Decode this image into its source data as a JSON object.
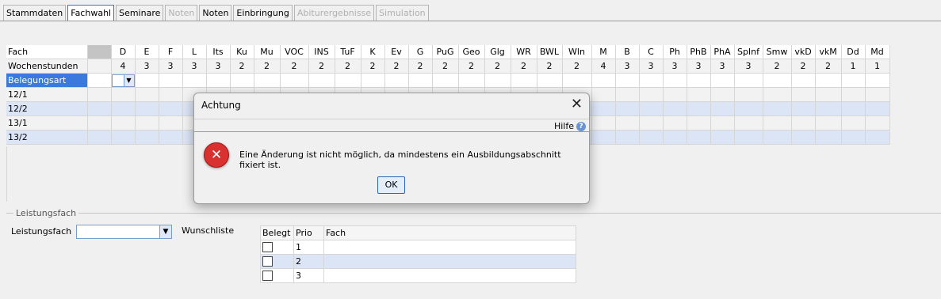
{
  "tabs": [
    {
      "label": "Stammdaten",
      "state": "normal"
    },
    {
      "label": "Fachwahl",
      "state": "active"
    },
    {
      "label": "Seminare",
      "state": "normal"
    },
    {
      "label": "Noten",
      "state": "disabled"
    },
    {
      "label": "Noten",
      "state": "normal"
    },
    {
      "label": "Einbringung",
      "state": "normal"
    },
    {
      "label": "Abiturergebnisse",
      "state": "disabled"
    },
    {
      "label": "Simulation",
      "state": "disabled"
    }
  ],
  "grid": {
    "fach_label": "Fach",
    "wochenstunden_label": "Wochenstunden",
    "subjects": [
      "D",
      "E",
      "F",
      "L",
      "Its",
      "Ku",
      "Mu",
      "VOC",
      "INS",
      "TuF",
      "K",
      "Ev",
      "G",
      "PuG",
      "Geo",
      "Glg",
      "WR",
      "BWL",
      "Wln",
      "M",
      "B",
      "C",
      "Ph",
      "PhB",
      "PhA",
      "SpInf",
      "Smw",
      "vkD",
      "vkM",
      "Dd",
      "Md"
    ],
    "hours": [
      "4",
      "3",
      "3",
      "3",
      "3",
      "2",
      "2",
      "2",
      "2",
      "2",
      "2",
      "2",
      "2",
      "2",
      "2",
      "2",
      "2",
      "2",
      "2",
      "4",
      "3",
      "3",
      "3",
      "3",
      "3",
      "3",
      "2",
      "2",
      "2",
      "1",
      "1"
    ],
    "rows": [
      "Belegungsart",
      "12/1",
      "12/2",
      "13/1",
      "13/2"
    ]
  },
  "leistungsfach": {
    "section_title": "Leistungsfach",
    "field_label": "Leistungsfach",
    "field_value": "",
    "wunschliste_label": "Wunschliste",
    "wish_headers": [
      "Belegt",
      "Prio",
      "Fach"
    ],
    "wish_rows": [
      {
        "prio": "1",
        "fach": ""
      },
      {
        "prio": "2",
        "fach": ""
      },
      {
        "prio": "3",
        "fach": ""
      }
    ]
  },
  "dialog": {
    "title": "Achtung",
    "help_label": "Hilfe",
    "message": "Eine Änderung ist nicht möglich, da mindestens ein Ausbildungsabschnitt fixiert ist.",
    "ok_label": "OK",
    "icon": "error-icon"
  },
  "colors": {
    "accent": "#3a79dd",
    "band": "#dbe5f6",
    "error": "#d93030"
  }
}
